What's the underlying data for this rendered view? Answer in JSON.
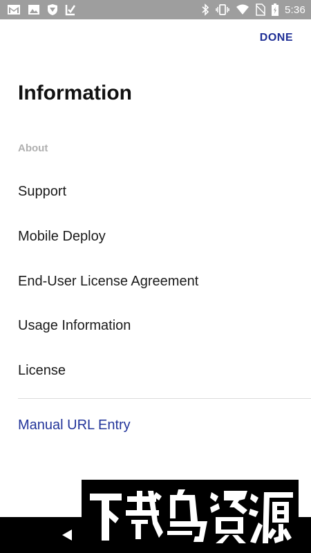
{
  "status_bar": {
    "time": "5:36",
    "icons": [
      "gmail-icon",
      "image-icon",
      "shield-icon",
      "download-icon",
      "bluetooth-icon",
      "vibrate-icon",
      "wifi-icon",
      "no-sim-icon",
      "battery-icon"
    ]
  },
  "header": {
    "done_label": "DONE",
    "title": "Information"
  },
  "section": {
    "label": "About",
    "items": [
      {
        "label": "Support"
      },
      {
        "label": "Mobile Deploy"
      },
      {
        "label": "End-User License Agreement"
      },
      {
        "label": "Usage Information"
      },
      {
        "label": "License"
      }
    ]
  },
  "link": {
    "label": "Manual URL Entry"
  },
  "nav_bar": {
    "icons": [
      "back-icon"
    ]
  },
  "watermark": {
    "text": "下载鸟资源"
  },
  "colors": {
    "accent": "#1f2f96",
    "link": "#22349a",
    "status_bar": "#9e9e9e",
    "section_header": "#b0b0b0"
  }
}
